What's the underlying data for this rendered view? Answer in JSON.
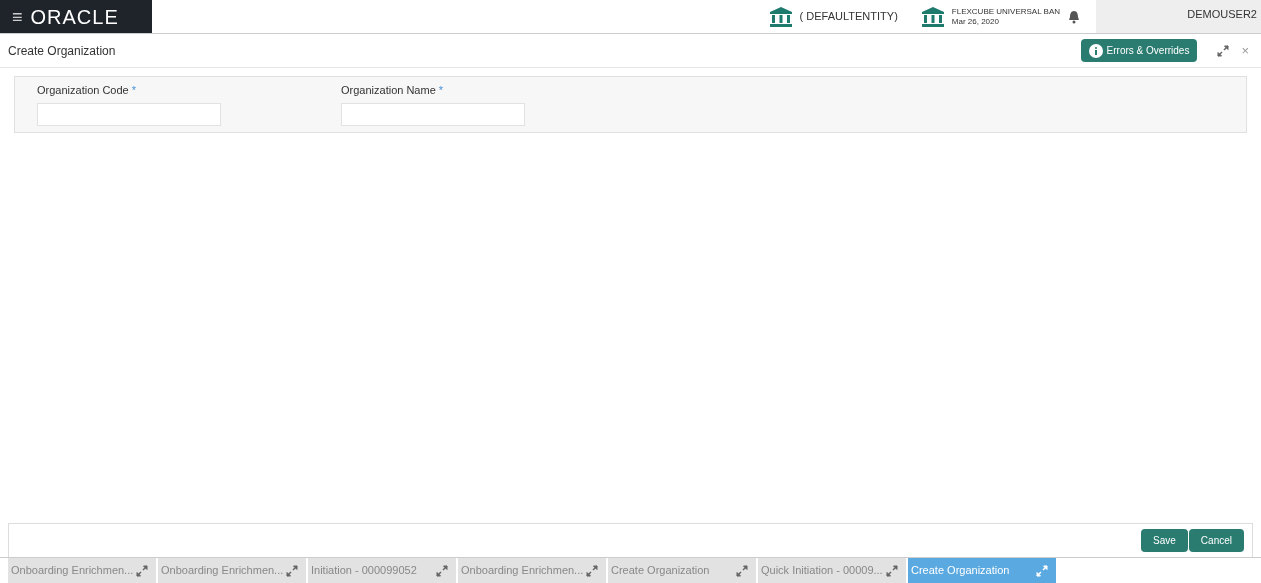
{
  "header": {
    "menu_glyph": "≡",
    "logo": "ORACLE",
    "entity": "( DEFAULTENTITY)",
    "branch": "FLEXCUBE UNIVERSAL BAN",
    "date": "Mar 26, 2020",
    "user": "DEMOUSER2"
  },
  "page": {
    "title": "Create Organization",
    "errors_button": "Errors & Overrides",
    "close_glyph": "×"
  },
  "fields": [
    {
      "label": "Organization Code",
      "required": true
    },
    {
      "label": "Organization Name",
      "required": true
    }
  ],
  "required_mark": "*",
  "actions": [
    {
      "label": "Save"
    },
    {
      "label": "Cancel"
    }
  ],
  "tabs": [
    {
      "label": "Onboarding Enrichmen...",
      "selected": false
    },
    {
      "label": "Onboarding Enrichmen...",
      "selected": false
    },
    {
      "label": "Initiation - 000099052",
      "selected": false
    },
    {
      "label": "Onboarding Enrichmen...",
      "selected": false
    },
    {
      "label": "Create Organization",
      "selected": false
    },
    {
      "label": "Quick Initiation - 00009...",
      "selected": false
    },
    {
      "label": "Create Organization",
      "selected": true
    }
  ]
}
